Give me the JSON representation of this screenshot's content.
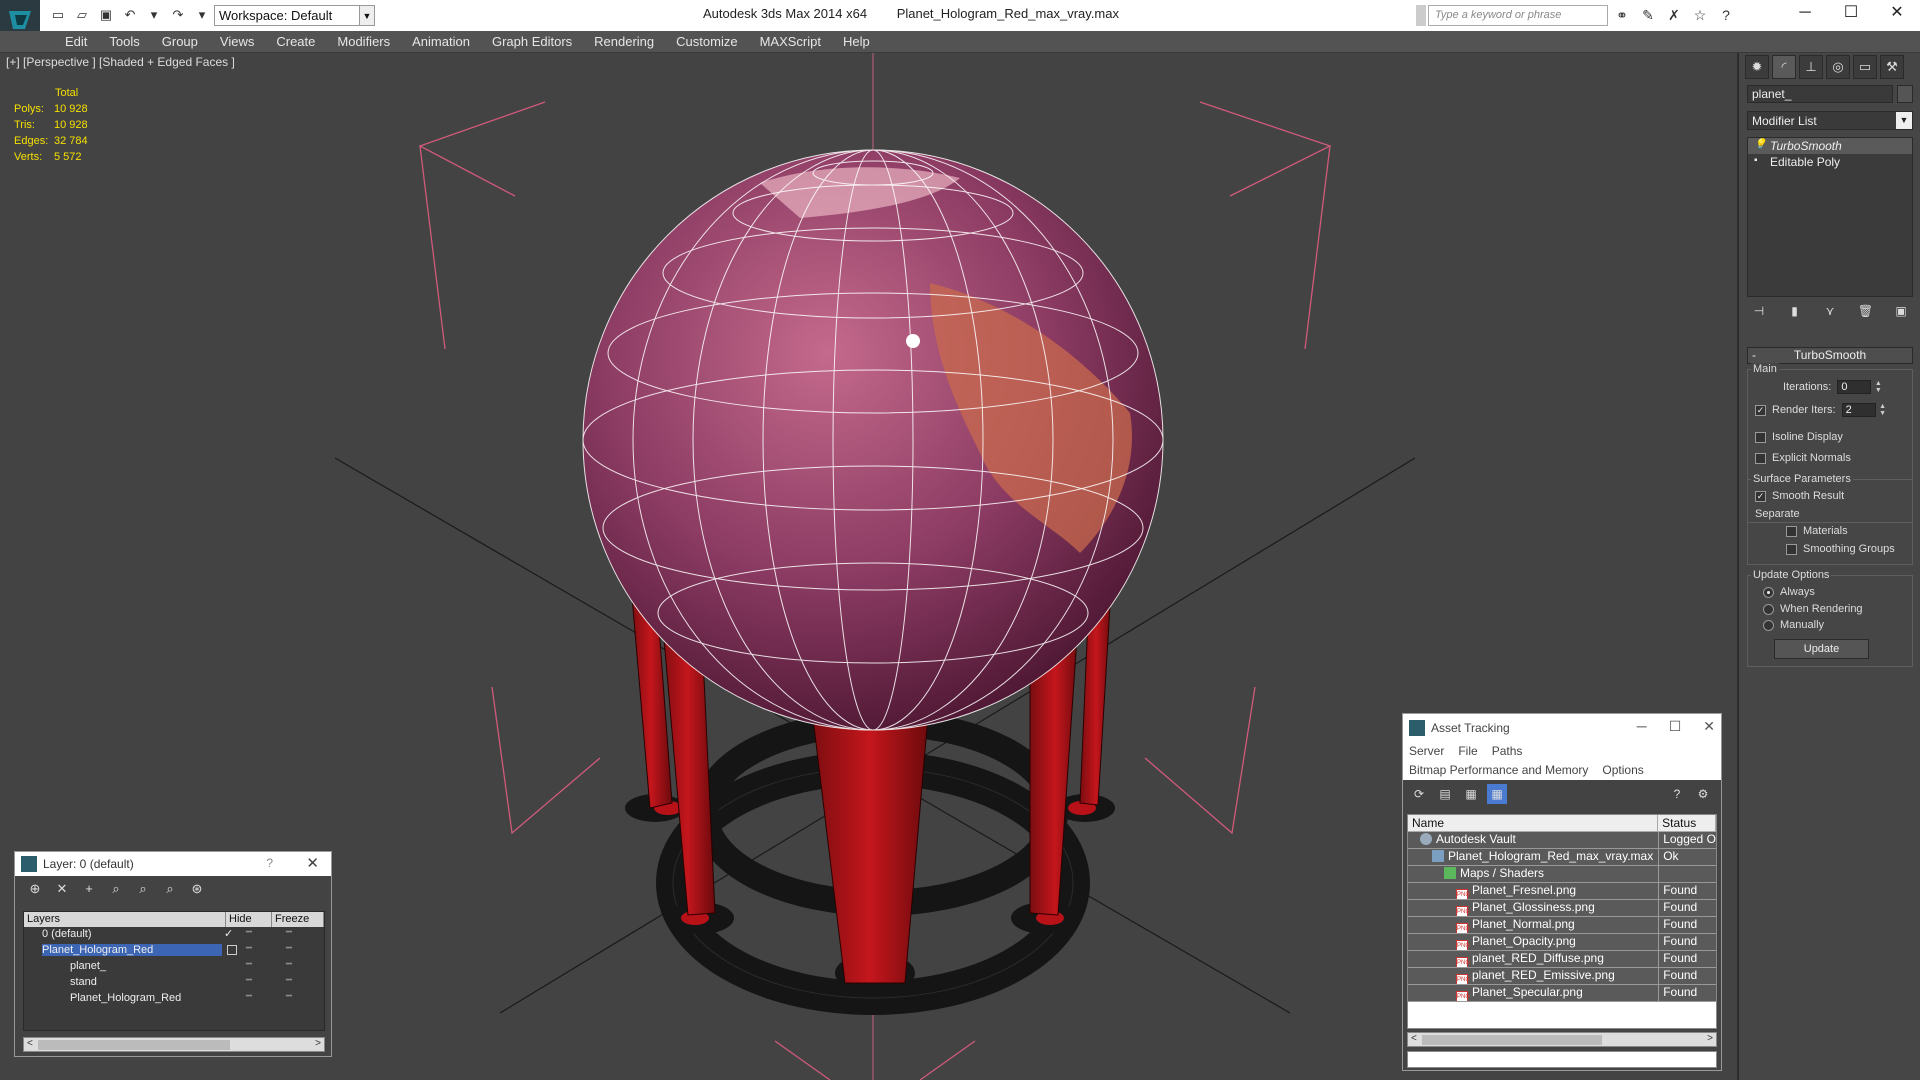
{
  "titlebar": {
    "app_title": "Autodesk 3ds Max  2014 x64",
    "file_name": "Planet_Hologram_Red_max_vray.max",
    "workspace": "Workspace: Default",
    "search_placeholder": "Type a keyword or phrase"
  },
  "menu": [
    "Edit",
    "Tools",
    "Group",
    "Views",
    "Create",
    "Modifiers",
    "Animation",
    "Graph Editors",
    "Rendering",
    "Customize",
    "MAXScript",
    "Help"
  ],
  "viewport": {
    "label": "[+] [Perspective ] [Shaded + Edged Faces ]",
    "stats_header": "Total",
    "stats": [
      {
        "k": "Polys:",
        "v": "10 928"
      },
      {
        "k": "Tris:",
        "v": "10 928"
      },
      {
        "k": "Edges:",
        "v": "32 784"
      },
      {
        "k": "Verts:",
        "v": "5 572"
      }
    ]
  },
  "command_panel": {
    "object_name": "planet_",
    "modifier_list": "Modifier List",
    "stack": [
      "TurboSmooth",
      "Editable Poly"
    ],
    "rollout_title": "TurboSmooth",
    "main_label": "Main",
    "iterations_label": "Iterations:",
    "iterations_value": "0",
    "render_iters_label": "Render Iters:",
    "render_iters_value": "2",
    "isoline_label": "Isoline Display",
    "explicit_normals_label": "Explicit Normals",
    "surface_params_label": "Surface Parameters",
    "smooth_result_label": "Smooth Result",
    "separate_label": "Separate",
    "materials_label": "Materials",
    "smoothing_groups_label": "Smoothing Groups",
    "update_options_label": "Update Options",
    "always_label": "Always",
    "when_rendering_label": "When Rendering",
    "manually_label": "Manually",
    "update_button": "Update"
  },
  "layer_dialog": {
    "title": "Layer: 0 (default)",
    "help": "?",
    "columns": [
      "Layers",
      "Hide",
      "Freeze"
    ],
    "rows": [
      "0 (default)",
      "Planet_Hologram_Red",
      "planet_",
      "stand",
      "Planet_Hologram_Red"
    ]
  },
  "asset_tracking": {
    "title": "Asset Tracking",
    "menu1": [
      "Server",
      "File",
      "Paths"
    ],
    "menu2": [
      "Bitmap Performance and Memory",
      "Options"
    ],
    "columns": [
      "Name",
      "Status"
    ],
    "rows": [
      {
        "name": "Autodesk Vault",
        "status": "Logged O",
        "indent": 1,
        "icon": "vault"
      },
      {
        "name": "Planet_Hologram_Red_max_vray.max",
        "status": "Ok",
        "indent": 2,
        "icon": "max"
      },
      {
        "name": "Maps / Shaders",
        "status": "",
        "indent": 3,
        "icon": "maps"
      },
      {
        "name": "Planet_Fresnel.png",
        "status": "Found",
        "indent": 4,
        "icon": "png"
      },
      {
        "name": "Planet_Glossiness.png",
        "status": "Found",
        "indent": 4,
        "icon": "png"
      },
      {
        "name": "Planet_Normal.png",
        "status": "Found",
        "indent": 4,
        "icon": "png"
      },
      {
        "name": "Planet_Opacity.png",
        "status": "Found",
        "indent": 4,
        "icon": "png"
      },
      {
        "name": "planet_RED_Diffuse.png",
        "status": "Found",
        "indent": 4,
        "icon": "png"
      },
      {
        "name": "planet_RED_Emissive.png",
        "status": "Found",
        "indent": 4,
        "icon": "png"
      },
      {
        "name": "Planet_Specular.png",
        "status": "Found",
        "indent": 4,
        "icon": "png"
      }
    ]
  },
  "colors": {
    "stats_yellow": "#f6e000",
    "selection_blue": "#3c66b4",
    "leg_red": "#c4161c",
    "globe_purple": "#8c3b63"
  }
}
